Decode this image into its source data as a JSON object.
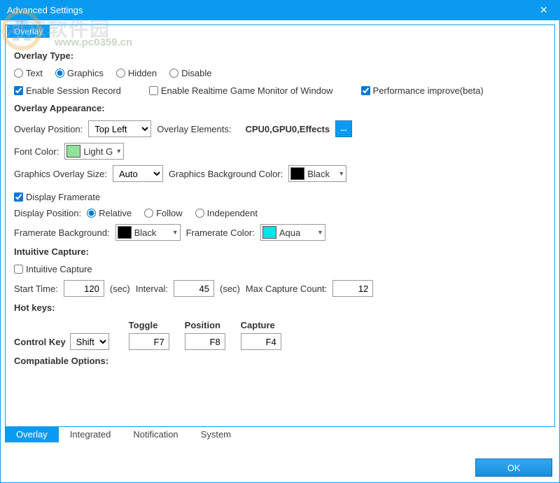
{
  "title": "Advanced Settings",
  "watermark": {
    "text": "河东软件园",
    "url": "www.pc0359.cn"
  },
  "inner_tab": "Overlay",
  "sections": {
    "overlay_type": {
      "header": "Overlay Type:",
      "options": {
        "text": "Text",
        "graphics": "Graphics",
        "hidden": "Hidden",
        "disable": "Disable"
      },
      "enable_session_record": "Enable Session Record",
      "enable_realtime_monitor": "Enable Realtime Game Monitor of Window",
      "performance_improve": "Performance improve(beta)"
    },
    "overlay_appearance": {
      "header": "Overlay Appearance:",
      "position_label": "Overlay Position:",
      "position_value": "Top Left",
      "elements_label": "Overlay Elements:",
      "elements_value": "CPU0,GPU0,Effects",
      "elements_btn": "...",
      "font_color_label": "Font Color:",
      "font_color_value": "Light G",
      "size_label": "Graphics Overlay Size:",
      "size_value": "Auto",
      "bg_label": "Graphics Background Color:",
      "bg_value": "Black"
    },
    "framerate": {
      "display_framerate": "Display Framerate",
      "position_label": "Display Position:",
      "pos_relative": "Relative",
      "pos_follow": "Follow",
      "pos_independent": "Independent",
      "bg_label": "Framerate Background:",
      "bg_value": "Black",
      "color_label": "Framerate Color:",
      "color_value": "Aqua"
    },
    "intuitive": {
      "header": "Intuitive Capture:",
      "intuitive_capture": "Intuitive Capture",
      "start_time_label": "Start Time:",
      "start_time_value": "120",
      "sec1": "(sec)",
      "interval_label": "Interval:",
      "interval_value": "45",
      "sec2": "(sec)",
      "max_label": "Max Capture Count:",
      "max_value": "12"
    },
    "hotkeys": {
      "header": "Hot keys:",
      "control_key_label": "Control Key",
      "control_key_value": "Shift",
      "col_toggle": "Toggle",
      "col_position": "Position",
      "col_capture": "Capture",
      "toggle": "F7",
      "position": "F8",
      "capture": "F4"
    },
    "compat": {
      "header": "Compatiable Options:"
    }
  },
  "bottom_tabs": {
    "overlay": "Overlay",
    "integrated": "Integrated",
    "notification": "Notification",
    "system": "System"
  },
  "ok": "OK"
}
